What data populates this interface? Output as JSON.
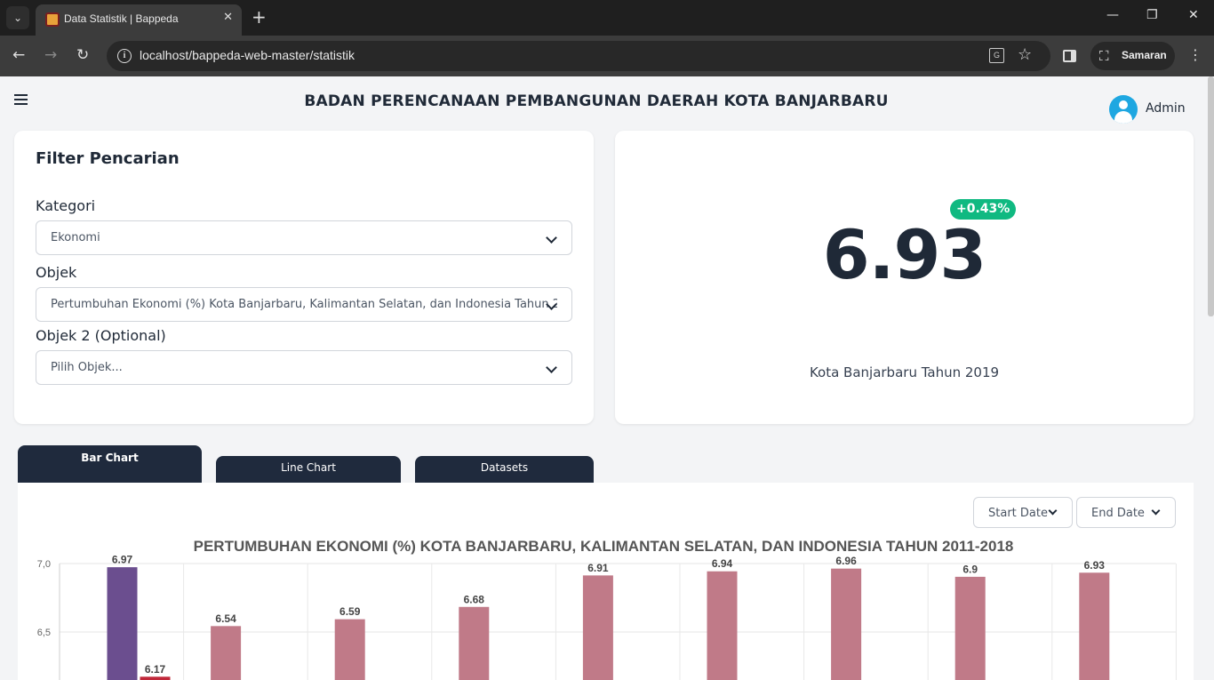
{
  "browser": {
    "tab_title": "Data Statistik | Bappeda",
    "url": "localhost/bappeda-web-master/statistik",
    "profile_label": "Samaran"
  },
  "header": {
    "title": "BADAN PERENCANAAN PEMBANGUNAN DAERAH KOTA BANJARBARU",
    "user": "Admin"
  },
  "filter": {
    "title": "Filter Pencarian",
    "kategori_label": "Kategori",
    "kategori_value": "Ekonomi",
    "objek_label": "Objek",
    "objek_value": "Pertumbuhan Ekonomi (%) Kota Banjarbaru, Kalimantan Selatan, dan Indonesia Tahun 2011-2018",
    "objek2_label": "Objek 2 (Optional)",
    "objek2_placeholder": "Pilih Objek..."
  },
  "stat": {
    "value": "6.93",
    "change": "+0.43%",
    "caption": "Kota Banjarbaru Tahun 2019"
  },
  "tabs": {
    "bar": "Bar Chart",
    "line": "Line Chart",
    "datasets": "Datasets"
  },
  "date_filter": {
    "start": "Start Date",
    "end": "End Date"
  },
  "chart_data": {
    "type": "bar",
    "title": "PERTUMBUHAN EKONOMI (%) KOTA BANJARBARU, KALIMANTAN SELATAN, DAN INDONESIA TAHUN 2011-2018",
    "y_ticks": [
      "7,0",
      "6,5"
    ],
    "ylim": [
      6.0,
      7.0
    ],
    "grid": true,
    "bars": [
      {
        "group": 0,
        "value": 6.97,
        "label": "6.97",
        "color": "#6b4e8f"
      },
      {
        "group": 0,
        "value": 6.17,
        "label": "6.17",
        "color": "#c0283a"
      },
      {
        "group": 1,
        "value": 6.54,
        "label": "6.54",
        "color": "#c07a88"
      },
      {
        "group": 2,
        "value": 6.59,
        "label": "6.59",
        "color": "#c07a88"
      },
      {
        "group": 3,
        "value": 6.68,
        "label": "6.68",
        "color": "#c07a88"
      },
      {
        "group": 4,
        "value": 6.91,
        "label": "6.91",
        "color": "#c07a88"
      },
      {
        "group": 5,
        "value": 6.94,
        "label": "6.94",
        "color": "#c07a88"
      },
      {
        "group": 6,
        "value": 6.96,
        "label": "6.96",
        "color": "#c07a88"
      },
      {
        "group": 7,
        "value": 6.9,
        "label": "6.9",
        "color": "#c07a88"
      },
      {
        "group": 8,
        "value": 6.93,
        "label": "6.93",
        "color": "#c07a88"
      }
    ]
  }
}
